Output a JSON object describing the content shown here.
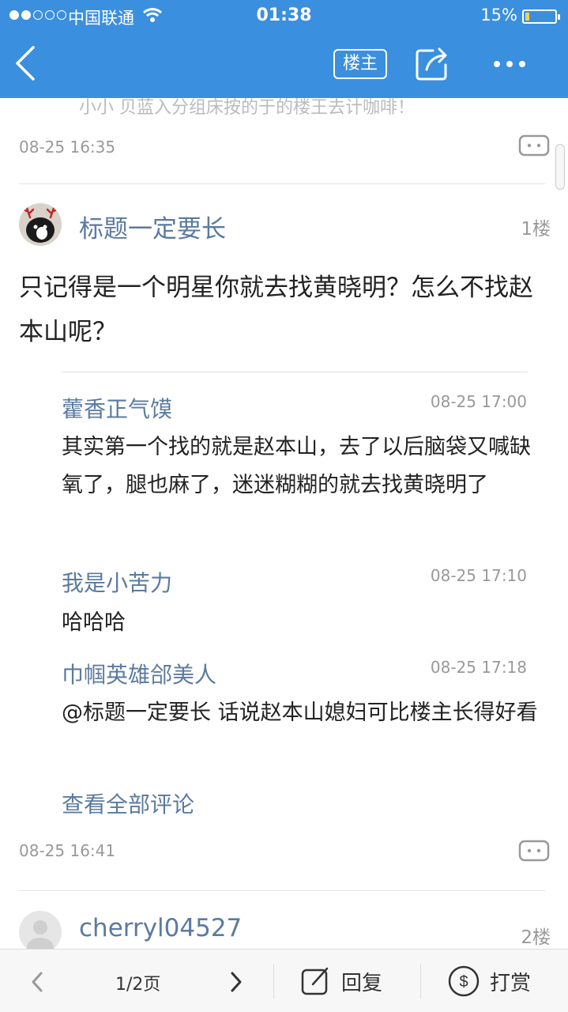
{
  "status_bar": {
    "carrier": "中国联通",
    "time": "01:38",
    "battery_percent": "15%",
    "battery_level": 0.15
  },
  "nav": {
    "owner_label": "楼主",
    "icons": [
      "back-icon",
      "share-icon",
      "more-icon"
    ]
  },
  "previous_post": {
    "cut_text": "小小 贝蓝入分组床按的于的楼王去计咖啡！",
    "date": "08-25 16:35"
  },
  "post": {
    "author": "标题一定要长",
    "floor": "1楼",
    "text": "只记得是一个明星你就去找黄晓明？怎么不找赵本山呢？",
    "date": "08-25 16:41",
    "replies": [
      {
        "name": "藿香正气馍",
        "time": "08-25 17:00",
        "text": "其实第一个找的就是赵本山，去了以后脑袋又喊缺氧了，腿也麻了，迷迷糊糊的就去找黄晓明了"
      },
      {
        "name": "我是小苦力",
        "time": "08-25 17:10",
        "text": "哈哈哈"
      },
      {
        "name": "巾帼英雄郃美人",
        "time": "08-25 17:18",
        "text": "@标题一定要长 话说赵本山媳妇可比楼主长得好看"
      }
    ],
    "view_all": "查看全部评论"
  },
  "next_post": {
    "author": "cherryl04527",
    "floor": "2楼"
  },
  "bottom_bar": {
    "page_indicator": "1/2页",
    "reply_label": "回复",
    "tip_label": "打赏"
  },
  "colors": {
    "header_blue": "#3b8fdf",
    "link_blue": "#5b7aa0"
  }
}
